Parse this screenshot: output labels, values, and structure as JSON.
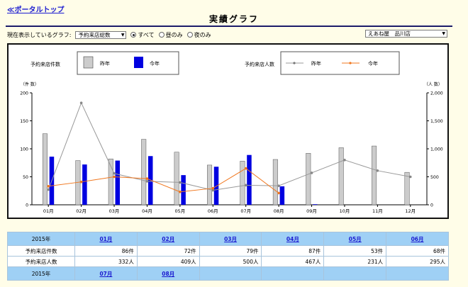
{
  "header": {
    "portal_link": "≪ポータルトップ",
    "title": "実績グラフ"
  },
  "controls": {
    "graph_label": "現在表示しているグラフ:",
    "graph_select": "予約来店総数",
    "radio_options": [
      {
        "label": "すべて",
        "selected": true
      },
      {
        "label": "昼のみ",
        "selected": false
      },
      {
        "label": "夜のみ",
        "selected": false
      }
    ],
    "store_select": "えあね屋　品川店"
  },
  "chart_data": {
    "type": "bar",
    "categories": [
      "01月",
      "02月",
      "03月",
      "04月",
      "05月",
      "06月",
      "07月",
      "08月",
      "09月",
      "10月",
      "11月",
      "12月"
    ],
    "legend_left": {
      "title": "予約来店件数",
      "items": [
        "昨年",
        "今年"
      ]
    },
    "legend_right": {
      "title": "予約来店人数",
      "items": [
        "昨年",
        "今年"
      ]
    },
    "left_axis": {
      "unit_label": "（件 数）",
      "ylim": [
        0,
        200
      ],
      "ticks": [
        "0",
        "50",
        "100",
        "150",
        "200"
      ]
    },
    "right_axis": {
      "unit_label": "（人 数）",
      "ylim": [
        0,
        2000
      ],
      "ticks": [
        "0",
        "500",
        "1,000",
        "1,500",
        "2,000"
      ]
    },
    "series": [
      {
        "name": "昨年",
        "kind": "bar",
        "axis": "left",
        "color": "#cccccc",
        "values": [
          127,
          79,
          82,
          117,
          94,
          71,
          78,
          81,
          92,
          102,
          105,
          58
        ]
      },
      {
        "name": "今年",
        "kind": "bar",
        "axis": "left",
        "color": "#0000e0",
        "values": [
          86,
          72,
          79,
          87,
          53,
          68,
          89,
          33,
          1,
          null,
          null,
          null
        ]
      },
      {
        "name": "昨年",
        "kind": "line",
        "axis": "right",
        "color": "#999999",
        "values": [
          270,
          1820,
          560,
          420,
          400,
          260,
          350,
          340,
          570,
          800,
          610,
          500
        ]
      },
      {
        "name": "今年",
        "kind": "line",
        "axis": "right",
        "color": "#f07820",
        "values": [
          332,
          409,
          500,
          467,
          231,
          295,
          650,
          210,
          null,
          null,
          null,
          null
        ]
      }
    ],
    "grid": false,
    "legend_position": "top"
  },
  "table": {
    "row1": {
      "year": "2015年",
      "months": [
        "01月",
        "02月",
        "03月",
        "04月",
        "05月",
        "06月"
      ],
      "rows": [
        {
          "label": "予約来店件数",
          "values": [
            "86件",
            "72件",
            "79件",
            "87件",
            "53件",
            "68件"
          ]
        },
        {
          "label": "予約来店人数",
          "values": [
            "332人",
            "409人",
            "500人",
            "467人",
            "231人",
            "295人"
          ]
        }
      ]
    },
    "row2": {
      "year": "2015年",
      "months": [
        "07月",
        "08月",
        "",
        "",
        "",
        ""
      ]
    }
  },
  "colors": {
    "accent_link": "#1a1ad0",
    "table_header": "#9fd0f5",
    "bar_last_year": "#cccccc",
    "bar_this_year": "#0000e0",
    "line_last_year": "#999999",
    "line_this_year": "#f07820"
  }
}
